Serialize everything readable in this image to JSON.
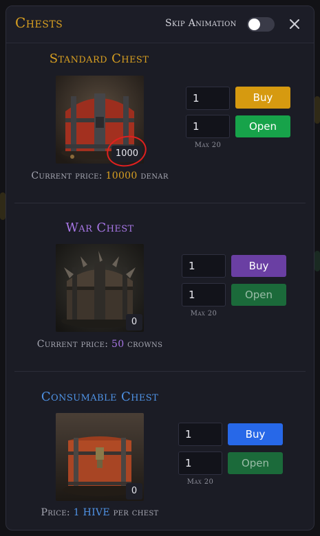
{
  "header": {
    "title": "Chests",
    "skip_animation_label": "Skip Animation",
    "skip_animation_on": false,
    "close_icon": "close-icon"
  },
  "chests": [
    {
      "title": "Standard Chest",
      "title_color": "#d9a021",
      "owned_count": "1000",
      "price_label": "Current price: ",
      "price_value": "10000",
      "price_unit": " denar",
      "price_color": "#d9a021",
      "buy_qty": "1",
      "open_qty": "1",
      "buy_label": "Buy",
      "open_label": "Open",
      "max_label": "Max 20",
      "buy_color": "#d69a10",
      "open_color": "#17a34a",
      "open_enabled": true
    },
    {
      "title": "War Chest",
      "title_color": "#a877e6",
      "owned_count": "0",
      "price_label": "Current price: ",
      "price_value": "50",
      "price_unit": " crowns",
      "price_color": "#a877e6",
      "buy_qty": "1",
      "open_qty": "1",
      "buy_label": "Buy",
      "open_label": "Open",
      "max_label": "Max 20",
      "buy_color": "#6a3fa3",
      "open_color": "#1b6a3a",
      "open_enabled": false
    },
    {
      "title": "Consumable Chest",
      "title_color": "#4f93e6",
      "owned_count": "0",
      "price_label": "Price: ",
      "price_value": "1 HIVE",
      "price_unit": " per chest",
      "price_color": "#4f93e6",
      "buy_qty": "1",
      "open_qty": "1",
      "buy_label": "Buy",
      "open_label": "Open",
      "max_label": "Max 20",
      "buy_color": "#2768e8",
      "open_color": "#1b6a3a",
      "open_enabled": false
    }
  ]
}
